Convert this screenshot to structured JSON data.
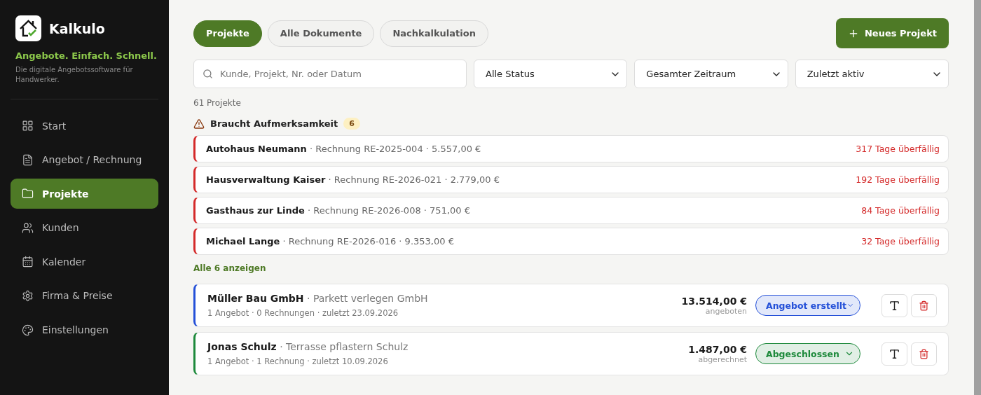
{
  "brand": {
    "name": "Kalkulo",
    "tagline": "Angebote. Einfach. Schnell.",
    "description": "Die digitale Angebotssoftware für Handwerker."
  },
  "nav": [
    {
      "label": "Start",
      "selected": false
    },
    {
      "label": "Angebot / Rechnung",
      "selected": false
    },
    {
      "label": "Projekte",
      "selected": true
    },
    {
      "label": "Kunden",
      "selected": false
    },
    {
      "label": "Kalender",
      "selected": false
    },
    {
      "label": "Firma & Preise",
      "selected": false
    },
    {
      "label": "Einstellungen",
      "selected": false
    }
  ],
  "tabs": [
    {
      "label": "Projekte",
      "selected": true
    },
    {
      "label": "Alle Dokumente",
      "selected": false
    },
    {
      "label": "Nachkalkulation",
      "selected": false
    }
  ],
  "new_button": "Neues Projekt",
  "search": {
    "placeholder": "Kunde, Projekt, Nr. oder Datum"
  },
  "filters": [
    "Alle Status",
    "Gesamter Zeitraum",
    "Zuletzt aktiv"
  ],
  "count": "61 Projekte",
  "attention": {
    "title": "Braucht Aufmerksamkeit",
    "badge": "6",
    "show_all": "Alle 6 anzeigen",
    "items": [
      {
        "summary": "**Autohaus Neumann** · Rechnung RE-2025-004 · 5.557,00 €",
        "overdue": "317 Tage überfällig"
      },
      {
        "summary": "**Hausverwaltung Kaiser** · Rechnung RE-2026-021 · 2.779,00 €",
        "overdue": "192 Tage überfällig"
      },
      {
        "summary": "**Gasthaus zur Linde** · Rechnung RE-2026-008 · 751,00 €",
        "overdue": "84 Tage überfällig"
      },
      {
        "summary": "**Michael Lange** · Rechnung RE-2026-016 · 9.353,00 €",
        "overdue": "32 Tage überfällig"
      }
    ]
  },
  "projects": [
    {
      "title": "**Müller Bau GmbH** · Parkett verlegen GmbH",
      "meta": "1 Angebot · 0 Rechnungen · zuletzt 23.09.2026",
      "amount": "13.514,00 €",
      "amount_label": "angeboten",
      "status": "Angebot erstellt",
      "color": "#2450d8"
    },
    {
      "title": "**Jonas Schulz** · Terrasse pflastern Schulz",
      "meta": "1 Angebot · 1 Rechnung · zuletzt 10.09.2026",
      "amount": "1.487,00 €",
      "amount_label": "abgerechnet",
      "status": "Abgeschlossen",
      "color": "#1e8a3c"
    }
  ]
}
